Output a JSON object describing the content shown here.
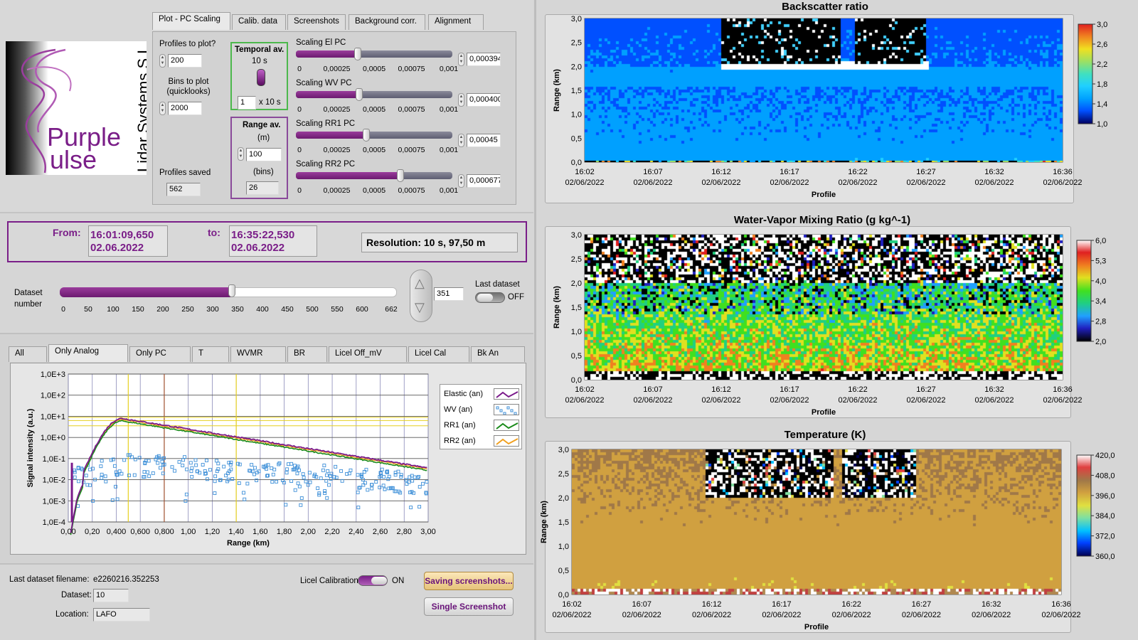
{
  "brand": {
    "line1": "Purple",
    "line2": "ulse",
    "side": "Lidar Systems S.L."
  },
  "tabs_top": [
    "Plot - PC Scaling",
    "Calib. data",
    "Screenshots",
    "Background corr.",
    "Alignment"
  ],
  "settings": {
    "profiles_label": "Profiles to plot?",
    "profiles_value": "200",
    "bins_label": "Bins to plot (quicklooks)",
    "bins_value": "2000",
    "saved_label": "Profiles saved",
    "saved_value": "562",
    "temporal_label": "Temporal av.",
    "temporal_seconds": "10 s",
    "temporal_value": "1",
    "temporal_unit": "x 10 s",
    "range_label": "Range av.",
    "range_unit_m": "(m)",
    "range_value": "100",
    "range_unit_bins": "(bins)",
    "range_bins": "26"
  },
  "scalings": [
    {
      "label": "Scaling El PC",
      "value": "0,000394",
      "level": 0.39
    },
    {
      "label": "Scaling WV PC",
      "value": "0,000400",
      "level": 0.4
    },
    {
      "label": "Scaling RR1 PC",
      "value": "0,00045",
      "level": 0.45
    },
    {
      "label": "Scaling RR2 PC",
      "value": "0,000677",
      "level": 0.68
    }
  ],
  "scaling_ticks": [
    "0",
    "0,00025",
    "0,0005",
    "0,00075",
    "0,001"
  ],
  "time": {
    "from_label": "From:",
    "from_time": "16:01:09,650",
    "from_date": "02.06.2022",
    "to_label": "to:",
    "to_time": "16:35:22,530",
    "to_date": "02.06.2022",
    "resolution": "Resolution: 10 s, 97,50 m"
  },
  "dataset": {
    "label_line1": "Dataset",
    "label_line2": "number",
    "value": "351",
    "level": 0.53,
    "ticks": [
      "0",
      "50",
      "100",
      "150",
      "200",
      "250",
      "300",
      "350",
      "400",
      "450",
      "500",
      "550",
      "600",
      "662"
    ],
    "last_label": "Last dataset",
    "last_state": "OFF"
  },
  "tabs_mid": [
    "All",
    "Only Analog",
    "Only PC",
    "T",
    "WVMR",
    "BR",
    "Licel Off_mV",
    "Licel Cal",
    "Bk An"
  ],
  "signal_chart": {
    "ylabel": "Signal intensity (a.u.)",
    "xlabel": "Range (km)",
    "yticks": [
      "1,0E+3",
      "1,0E+2",
      "1,0E+1",
      "1,0E+0",
      "1,0E-1",
      "1,0E-2",
      "1,0E-3",
      "1,0E-4"
    ],
    "xticks": [
      "0,00",
      "0,20",
      "0,400",
      "0,600",
      "0,800",
      "1,00",
      "1,20",
      "1,40",
      "1,60",
      "1,80",
      "2,00",
      "2,20",
      "2,40",
      "2,60",
      "2,80",
      "3,00"
    ],
    "legend": [
      {
        "name": "Elastic (an)",
        "color": "#7a1a8a"
      },
      {
        "name": "WV (an)",
        "color": "#3d8fd8"
      },
      {
        "name": "RR1 (an)",
        "color": "#1a8a1a"
      },
      {
        "name": "RR2 (an)",
        "color": "#f0a020"
      }
    ]
  },
  "footer": {
    "filename_label": "Last dataset filename:",
    "filename": "e2260216.352253",
    "dataset_label": "Dataset:",
    "dataset": "10",
    "location_label": "Location:",
    "location": "LAFO",
    "licel_label": "Licel Calibration",
    "licel_state": "ON",
    "save_btn": "Saving screenshots...",
    "single_btn": "Single Screenshot"
  },
  "quicklooks": [
    {
      "title": "Backscatter ratio",
      "ylabel": "Range (km)",
      "xlabel": "Profile",
      "yticks": [
        "3,0",
        "2,5",
        "2,0",
        "1,5",
        "1,0",
        "0,5",
        "0,0"
      ],
      "xticks": [
        "16:02",
        "16:07",
        "16:12",
        "16:17",
        "16:22",
        "16:27",
        "16:32",
        "16:36"
      ],
      "date": "02/06/2022",
      "scale": [
        "3,0",
        "2,6",
        "2,2",
        "1,8",
        "1,4",
        "1,0"
      ],
      "palette": "bsr"
    },
    {
      "title": "Water-Vapor Mixing Ratio  (g kg^-1)",
      "ylabel": "Range (km)",
      "xlabel": "Profile",
      "yticks": [
        "3,0",
        "2,5",
        "2,0",
        "1,5",
        "1,0",
        "0,5",
        "0,0"
      ],
      "xticks": [
        "16:02",
        "16:07",
        "16:12",
        "16:17",
        "16:22",
        "16:27",
        "16:32",
        "16:36"
      ],
      "date": "02/06/2022",
      "scale": [
        "6,0",
        "5,3",
        "4,0",
        "3,4",
        "2,8",
        "2,0"
      ],
      "palette": "wv"
    },
    {
      "title": "Temperature (K)",
      "ylabel": "Range (km)",
      "xlabel": "Profile",
      "yticks": [
        "3,0",
        "2,5",
        "2,0",
        "1,5",
        "1,0",
        "0,5",
        "0,0"
      ],
      "xticks": [
        "16:02",
        "16:07",
        "16:12",
        "16:17",
        "16:22",
        "16:27",
        "16:32",
        "16:36"
      ],
      "date": "02/06/2022",
      "scale": [
        "420,0",
        "408,0",
        "396,0",
        "384,0",
        "372,0",
        "360,0"
      ],
      "palette": "temp"
    }
  ]
}
